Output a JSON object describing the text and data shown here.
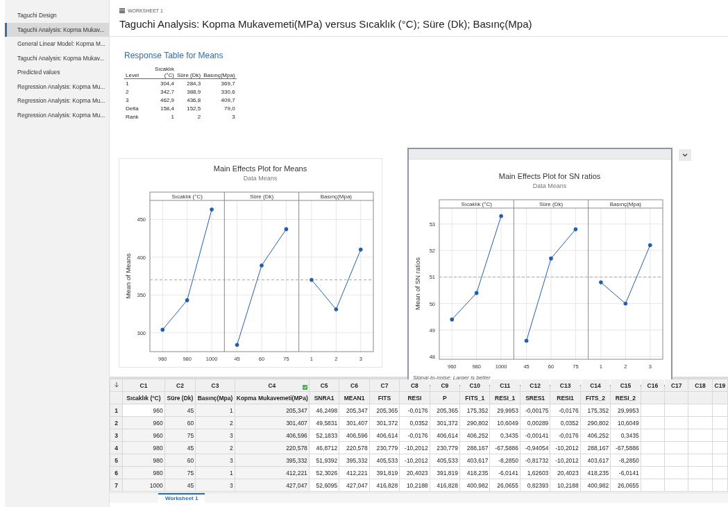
{
  "sidebar": {
    "items": [
      {
        "label": "Taguchi Design",
        "selected": false
      },
      {
        "label": "Taguchi Analysis: Kopma Mukav...",
        "selected": true
      },
      {
        "label": "General Linear Model: Kopma M...",
        "selected": false
      },
      {
        "label": "Taguchi Analysis: Kopma Mukav...",
        "selected": false
      },
      {
        "label": "Predicted values",
        "selected": false
      },
      {
        "label": "Regression Analysis: Kopma Mu...",
        "selected": false
      },
      {
        "label": "Regression Analysis: Kopma Mu...",
        "selected": false
      },
      {
        "label": "Regression Analysis: Kopma Mu...",
        "selected": false
      }
    ]
  },
  "worksheet": {
    "label": "WORKSHEET 1",
    "title": "Taguchi Analysis: Kopma Mukavemeti(MPa) versus Sıcaklık (°C); Süre (Dk); Basınç(Mpa)"
  },
  "response_table": {
    "title": "Response Table for Means",
    "columns": [
      "Level",
      "Sıcaklık (°C)",
      "Süre (Dk)",
      "Basınç(Mpa)"
    ],
    "rows": [
      [
        "1",
        "304,4",
        "284,3",
        "369,7"
      ],
      [
        "2",
        "342,7",
        "388,9",
        "330,6"
      ],
      [
        "3",
        "462,9",
        "436,8",
        "409,7"
      ],
      [
        "Delta",
        "158,4",
        "152,5",
        "79,0"
      ],
      [
        "Rank",
        "1",
        "2",
        "3"
      ]
    ]
  },
  "charts": [
    {
      "selected": false,
      "panel_headers": [
        "Sıcaklık (°C)",
        "Süre (Dk)",
        "Basınç(Mpa)"
      ],
      "chart_data": {
        "type": "line",
        "title": "Main Effects Plot for Means",
        "subtitle": "Data Means",
        "ylabel": "Mean of Means",
        "categories": [
          "960",
          "980",
          "1000",
          "45",
          "60",
          "75",
          "1",
          "2",
          "3"
        ],
        "series": [
          {
            "color": "#1f5fae",
            "values": [
              304,
              343,
              463,
              null,
              null,
              null,
              null,
              null,
              null
            ]
          },
          {
            "color": "#1f5fae",
            "values": [
              null,
              null,
              null,
              284,
              389,
              437,
              null,
              null,
              null
            ]
          },
          {
            "color": "#1f5fae",
            "values": [
              null,
              null,
              null,
              null,
              null,
              null,
              370,
              331,
              410
            ]
          }
        ],
        "ylim": [
          275,
          475
        ],
        "yticks": [
          300,
          350,
          400,
          450
        ],
        "grid": true,
        "ref_lines": [
          {
            "axis": "y",
            "value": 370
          }
        ]
      }
    },
    {
      "selected": true,
      "panel_headers": [
        "Sıcaklık (°C)",
        "Süre (Dk)",
        "Basınç(Mpa)"
      ],
      "footnote": "Signal-to-noise: Larger is better",
      "chart_data": {
        "type": "line",
        "title": "Main Effects Plot for SN ratios",
        "subtitle": "Data Means",
        "ylabel": "Mean of SN ratios",
        "categories": [
          "960",
          "980",
          "1000",
          "45",
          "60",
          "75",
          "1",
          "2",
          "3"
        ],
        "series": [
          {
            "color": "#1f5fae",
            "values": [
              49.4,
              50.4,
              53.3,
              null,
              null,
              null,
              null,
              null,
              null
            ]
          },
          {
            "color": "#1f5fae",
            "values": [
              null,
              null,
              null,
              48.6,
              51.7,
              52.8,
              null,
              null,
              null
            ]
          },
          {
            "color": "#1f5fae",
            "values": [
              null,
              null,
              null,
              null,
              null,
              null,
              50.8,
              50.0,
              52.2
            ]
          }
        ],
        "ylim": [
          47.9,
          53.6
        ],
        "yticks": [
          48,
          49,
          50,
          51,
          52,
          53
        ],
        "grid": true,
        "ref_lines": [
          {
            "axis": "y",
            "value": 51
          }
        ]
      }
    }
  ],
  "grid": {
    "columns": [
      {
        "id": "C1",
        "name": "Sıcaklık (°C)"
      },
      {
        "id": "C2",
        "name": "Süre (Dk)"
      },
      {
        "id": "C3",
        "name": "Basınç(Mpa)"
      },
      {
        "id": "C4",
        "name": "Kopma Mukavemeti(MPa)"
      },
      {
        "id": "C5",
        "name": "SNRA1"
      },
      {
        "id": "C6",
        "name": "MEAN1"
      },
      {
        "id": "C7",
        "name": "FITS"
      },
      {
        "id": "C8",
        "name": "RESI"
      },
      {
        "id": "C9",
        "name": "P"
      },
      {
        "id": "C10",
        "name": "FITS_1"
      },
      {
        "id": "C11",
        "name": "RESI_1"
      },
      {
        "id": "C12",
        "name": "SRES1"
      },
      {
        "id": "C13",
        "name": "RESI1"
      },
      {
        "id": "C14",
        "name": "FITS_2"
      },
      {
        "id": "C15",
        "name": "RESI_2"
      },
      {
        "id": "C16"
      },
      {
        "id": "C17"
      },
      {
        "id": "C18"
      },
      {
        "id": "C19"
      }
    ],
    "rows": [
      {
        "number": "1",
        "cells": [
          "960",
          "45",
          "1",
          "205,347",
          "46,2498",
          "205,347",
          "205,365",
          "-0,0176",
          "205,365",
          "175,352",
          "29,9953",
          "-0,00175",
          "-0,0176",
          "175,352",
          "29,9953"
        ]
      },
      {
        "number": "2",
        "cells": [
          "960",
          "60",
          "2",
          "301,407",
          "49,5831",
          "301,407",
          "301,372",
          "0,0352",
          "301,372",
          "290,802",
          "10,6049",
          "0,00289",
          "0,0352",
          "290,802",
          "10,6049"
        ]
      },
      {
        "number": "3",
        "cells": [
          "960",
          "75",
          "3",
          "406,596",
          "52,1833",
          "406,596",
          "406,614",
          "-0,0176",
          "406,614",
          "406,252",
          "0,3435",
          "-0,00141",
          "-0,0176",
          "406,252",
          "0,3435"
        ]
      },
      {
        "number": "4",
        "cells": [
          "980",
          "45",
          "2",
          "220,578",
          "46,8712",
          "220,578",
          "230,779",
          "-10,2012",
          "230,779",
          "288,167",
          "-67,5886",
          "-0,94054",
          "-10,2012",
          "288,167",
          "-67,5886"
        ]
      },
      {
        "number": "5",
        "cells": [
          "980",
          "60",
          "3",
          "395,332",
          "51,9392",
          "395,332",
          "405,533",
          "-10,2012",
          "405,533",
          "403,617",
          "-8,2850",
          "-0,81732",
          "-10,2012",
          "403,617",
          "-8,2850"
        ]
      },
      {
        "number": "6",
        "cells": [
          "980",
          "75",
          "1",
          "412,221",
          "52,3026",
          "412,221",
          "391,819",
          "20,4023",
          "391,819",
          "418,235",
          "-6,0141",
          "1,62603",
          "20,4023",
          "418,235",
          "-6,0141"
        ]
      },
      {
        "number": "7",
        "cells": [
          "1000",
          "45",
          "3",
          "427,047",
          "52,6095",
          "427,047",
          "416,828",
          "10,2188",
          "416,828",
          "400,982",
          "26,0655",
          "0,82393",
          "10,2188",
          "400,982",
          "26,0655"
        ]
      }
    ]
  },
  "sheet_tabs": [
    {
      "label": "Worksheet 1",
      "selected": true
    }
  ]
}
